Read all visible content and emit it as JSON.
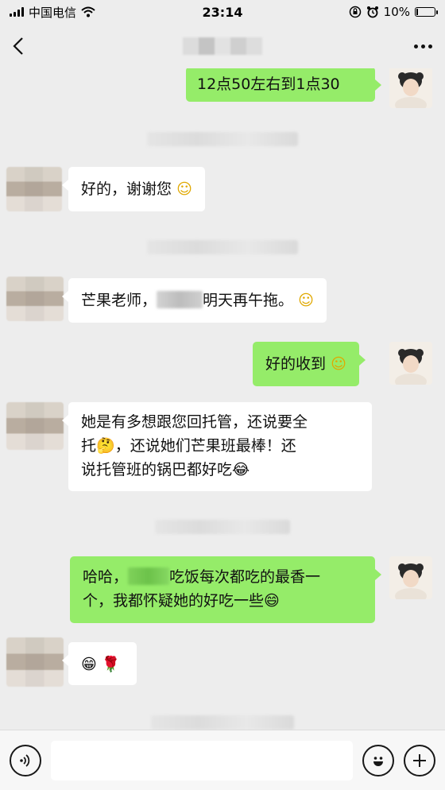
{
  "status_bar": {
    "carrier": "中国电信",
    "time": "23:14",
    "battery": "10%",
    "battery_level": 0.1,
    "icons": [
      "signal-icon",
      "wifi-icon",
      "rotation-lock-icon",
      "alarm-icon",
      "battery-icon"
    ]
  },
  "nav": {
    "back_icon": "chevron-left-icon",
    "more_icon": "more-dots-icon"
  },
  "messages": [
    {
      "side": "right",
      "text": "12点50左右到1点30"
    },
    {
      "type": "timestamp",
      "text": "2019年3月22日 15:40"
    },
    {
      "side": "left",
      "text": "好的，谢谢您",
      "emoji": "☺"
    },
    {
      "side": "left",
      "text_before": "芒果老师，",
      "text_after": "明天再午拖。",
      "emoji": "☺"
    },
    {
      "side": "right",
      "text": "好的收到",
      "emoji": "☺"
    },
    {
      "side": "left",
      "line1": "她是有多想跟您回托管，还说要全",
      "line2_a": "托",
      "emoji_think": "🤔",
      "line2_b": "，还说她们芒果班最棒！还",
      "line3": "说托管班的锅巴都好吃",
      "emoji_cry": "😂"
    },
    {
      "side": "right",
      "line1_a": "哈哈，",
      "line1_b": "吃饭每次都吃的最香一",
      "line2": "个，我都怀疑她的好吃一些",
      "emoji": "😄"
    },
    {
      "side": "left",
      "emoji1": "😁",
      "emoji2": "🌹"
    }
  ],
  "input": {
    "placeholder": "",
    "voice_icon": "voice-icon",
    "emoji_icon": "emoji-icon",
    "plus_icon": "plus-icon"
  },
  "colors": {
    "background": "#ededed",
    "bubble_right": "#95ec69",
    "bubble_left": "#ffffff"
  }
}
